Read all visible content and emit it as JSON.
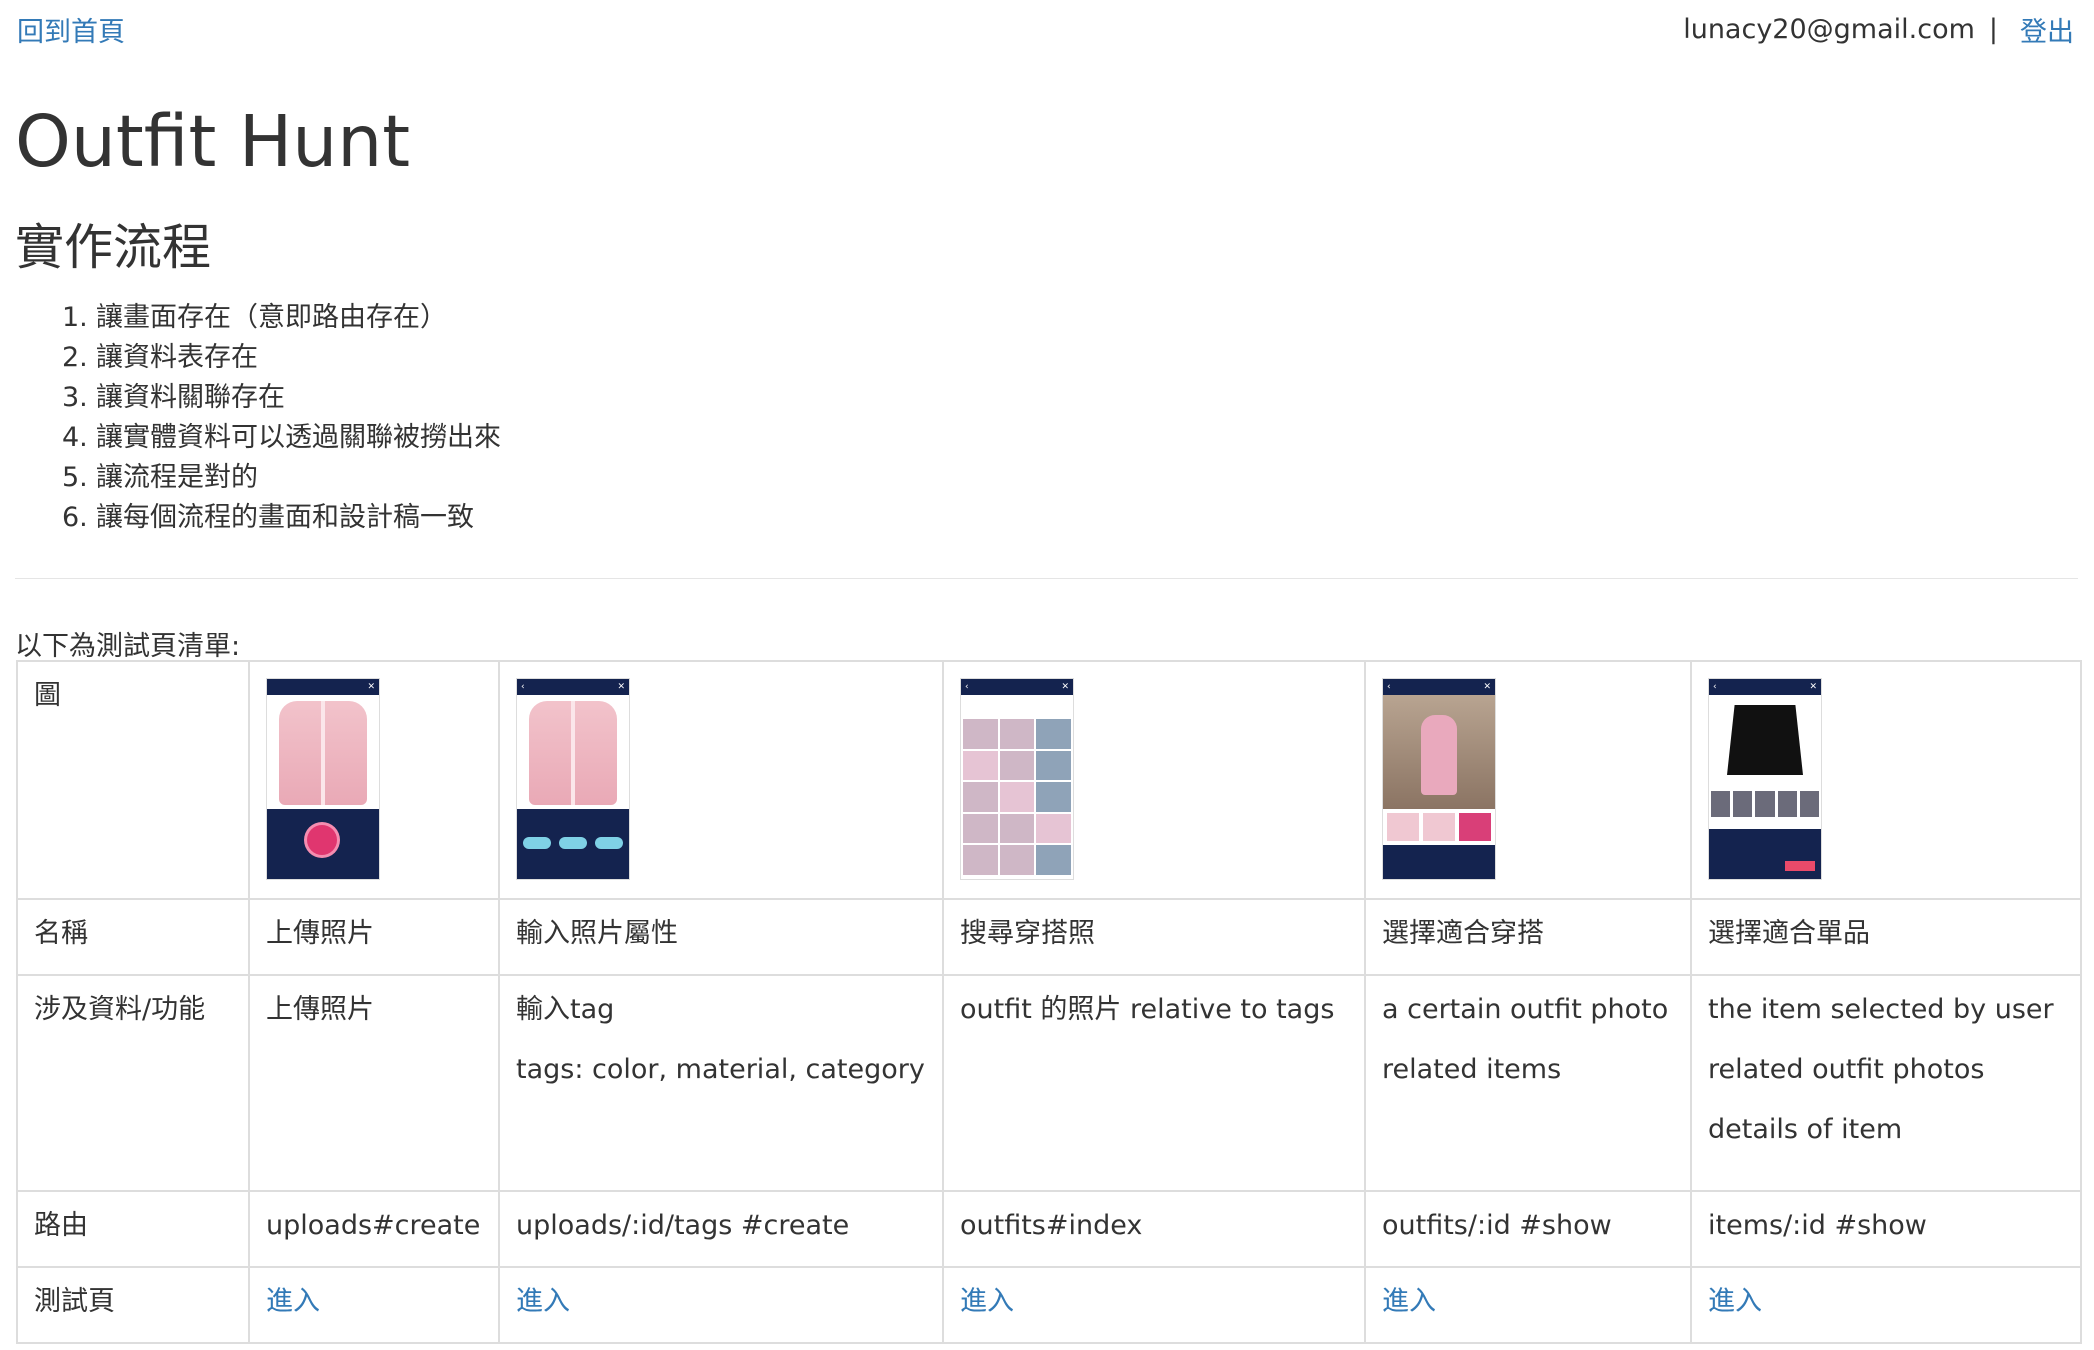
{
  "nav": {
    "home_link": "回到首頁",
    "user_email": "lunacy20@gmail.com",
    "separator": "|",
    "logout_link": "登出"
  },
  "page_title": "Outfit Hunt",
  "section_title": "實作流程",
  "steps": [
    {
      "num": "1.",
      "text": "讓畫面存在（意即路由存在）"
    },
    {
      "num": "2.",
      "text": "讓資料表存在"
    },
    {
      "num": "3.",
      "text": "讓資料關聯存在"
    },
    {
      "num": "4.",
      "text": "讓實體資料可以透過關聯被撈出來"
    },
    {
      "num": "5.",
      "text": "讓流程是對的"
    },
    {
      "num": "6.",
      "text": "讓每個流程的畫面和設計稿一致"
    }
  ],
  "list_caption": "以下為測試頁清單:",
  "table": {
    "row_labels": {
      "image": "圖",
      "name": "名稱",
      "data": "涉及資料/功能",
      "route": "路由",
      "test": "測試頁"
    },
    "columns": [
      {
        "name": "上傳照片",
        "data_lines": [
          "上傳照片"
        ],
        "route": "uploads#create",
        "link": "進入",
        "mock": "upload-photo-screen"
      },
      {
        "name": "輸入照片屬性",
        "data_lines": [
          "輸入tag",
          "tags: color, material, category"
        ],
        "route": "uploads/:id/tags #create",
        "link": "進入",
        "mock": "tag-input-screen"
      },
      {
        "name": "搜尋穿搭照",
        "data_lines": [
          "outfit 的照片 relative to tags"
        ],
        "route": "outfits#index",
        "link": "進入",
        "mock": "outfit-search-screen"
      },
      {
        "name": "選擇適合穿搭",
        "data_lines": [
          "a certain outfit photo",
          "related items"
        ],
        "route": "outfits/:id #show",
        "link": "進入",
        "mock": "outfit-detail-screen"
      },
      {
        "name": "選擇適合單品",
        "data_lines": [
          "the item selected by user",
          "related outfit photos",
          "details of item"
        ],
        "route": "items/:id #show",
        "link": "進入",
        "mock": "item-detail-screen"
      }
    ]
  },
  "colors": {
    "link": "#337ab7",
    "text": "#333333",
    "border": "#dddddd",
    "mock_navy": "#14234f",
    "mock_pink": "#e0366f"
  }
}
